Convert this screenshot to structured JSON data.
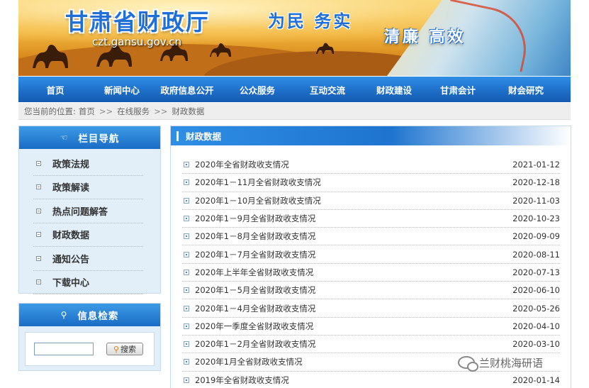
{
  "banner": {
    "site_title": "甘肃省财政厅",
    "domain": "czt.gansu.gov.cn",
    "slogan_primary": "为民 务实",
    "slogan_secondary": "清廉 高效"
  },
  "nav": {
    "items": [
      "首页",
      "新闻中心",
      "政府信息公开",
      "公众服务",
      "互动交流",
      "财政建设",
      "甘肃会计",
      "财会研究"
    ]
  },
  "breadcrumb": {
    "prefix": "您当前的位置:",
    "home": "首页",
    "separator": ">>",
    "section": "在线服务",
    "current": "财政数据"
  },
  "sidebar": {
    "title": "栏目导航",
    "items": [
      "政策法规",
      "政策解读",
      "热点问题解答",
      "财政数据",
      "通知公告",
      "下载中心"
    ]
  },
  "search": {
    "title": "信息检索",
    "input_value": "",
    "button_label": "搜索"
  },
  "main": {
    "title": "财政数据",
    "items": [
      {
        "title": "2020年全省财政收支情况",
        "date": "2021-01-12"
      },
      {
        "title": "2020年1－11月全省财政收支情况",
        "date": "2020-12-18"
      },
      {
        "title": "2020年1－10月全省财政收支情况",
        "date": "2020-11-03"
      },
      {
        "title": "2020年1－9月全省财政收支情况",
        "date": "2020-10-23"
      },
      {
        "title": "2020年1－8月全省财政收支情况",
        "date": "2020-09-09"
      },
      {
        "title": "2020年1－7月全省财政收支情况",
        "date": "2020-08-11"
      },
      {
        "title": "2020年上半年全省财政收支情况",
        "date": "2020-07-13"
      },
      {
        "title": "2020年1－5月全省财政收支情况",
        "date": "2020-06-10"
      },
      {
        "title": "2020年1－4月全省财政收支情况",
        "date": "2020-05-26"
      },
      {
        "title": "2020年一季度全省财政收支情况",
        "date": "2020-04-10"
      },
      {
        "title": "2020年1－2月全省财政收支情况",
        "date": "2020-03-10"
      },
      {
        "title": "2020年1月全省财政收支情况",
        "date": ""
      },
      {
        "title": "2019年全省财政收支情况",
        "date": "2020-01-14"
      }
    ]
  },
  "watermark": {
    "text": "兰财桃海研语"
  },
  "colors": {
    "nav_blue": "#1e6fc9",
    "sidebar_bg": "#e2eff8",
    "title_blue": "#1f6fd6"
  }
}
